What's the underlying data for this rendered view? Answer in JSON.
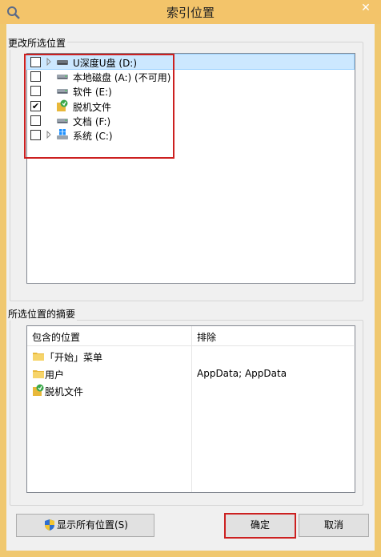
{
  "window": {
    "title": "索引位置",
    "close_glyph": "✕"
  },
  "change_group": {
    "label": "更改所选位置",
    "items": [
      {
        "label": "U深度U盘 (D:)",
        "checked": false,
        "expandable": true,
        "icon": "usb-drive-icon",
        "selected": true
      },
      {
        "label": "本地磁盘 (A:) (不可用)",
        "checked": false,
        "expandable": false,
        "icon": "drive-icon",
        "selected": false
      },
      {
        "label": "软件 (E:)",
        "checked": false,
        "expandable": false,
        "icon": "drive-icon",
        "selected": false
      },
      {
        "label": "脱机文件",
        "checked": true,
        "expandable": false,
        "icon": "offline-files-icon",
        "selected": false
      },
      {
        "label": "文档 (F:)",
        "checked": false,
        "expandable": false,
        "icon": "drive-icon",
        "selected": false
      },
      {
        "label": "系统 (C:)",
        "checked": false,
        "expandable": true,
        "icon": "windows-drive-icon",
        "selected": false
      }
    ]
  },
  "summary_group": {
    "label": "所选位置的摘要",
    "col_included": "包含的位置",
    "col_excluded": "排除",
    "rows": [
      {
        "included": "「开始」菜单",
        "excluded": "",
        "icon": "folder-icon"
      },
      {
        "included": "用户",
        "excluded": "AppData; AppData",
        "icon": "folder-icon"
      },
      {
        "included": "脱机文件",
        "excluded": "",
        "icon": "offline-files-icon"
      }
    ]
  },
  "buttons": {
    "show_all": "显示所有位置(S)",
    "ok": "确定",
    "cancel": "取消"
  },
  "colors": {
    "titlebar": "#f3c46a",
    "selection": "#cce8ff",
    "annotation": "#cc2020"
  }
}
